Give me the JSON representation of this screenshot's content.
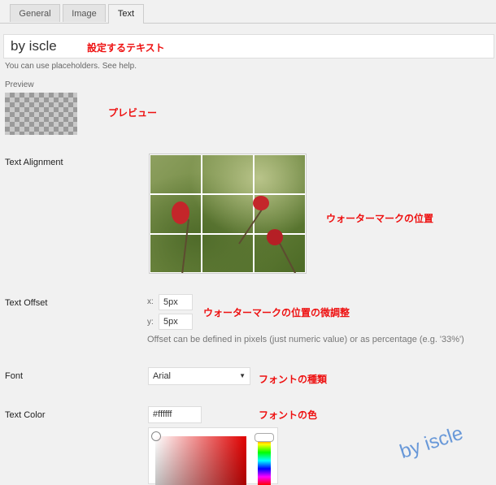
{
  "tabs": [
    {
      "label": "General",
      "active": false
    },
    {
      "label": "Image",
      "active": false
    },
    {
      "label": "Text",
      "active": true
    }
  ],
  "text_field": {
    "value": "by iscle"
  },
  "annotations": {
    "text": "設定するテキスト",
    "preview": "プレビュー",
    "position": "ウォーターマークの位置",
    "offset": "ウォーターマークの位置の微調整",
    "font": "フォントの種類",
    "color": "フォントの色"
  },
  "help_text": "You can use placeholders. See help.",
  "preview_label": "Preview",
  "alignment": {
    "label": "Text Alignment",
    "grid": "3x3"
  },
  "offset": {
    "label": "Text Offset",
    "x_label": "x:",
    "x_value": "5px",
    "y_label": "y:",
    "y_value": "5px",
    "help": "Offset can be defined in pixels (just numeric value) or as percentage (e.g. '33%')"
  },
  "font": {
    "label": "Font",
    "value": "Arial",
    "caret": "▼"
  },
  "color": {
    "label": "Text Color",
    "value": "#ffffff"
  },
  "watermark": "by iscle",
  "colors": {
    "annotation": "#ee1111",
    "watermark": "#5a8fd6"
  }
}
